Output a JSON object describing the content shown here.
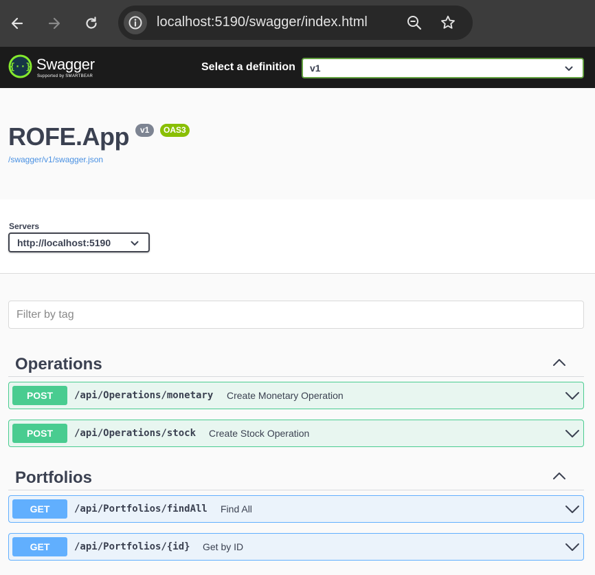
{
  "browser": {
    "url": "localhost:5190/swagger/index.html"
  },
  "topbar": {
    "logo_text": "Swagger",
    "logo_sub": "Supported by SMARTBEAR",
    "definition_label": "Select a definition",
    "definition_value": "v1"
  },
  "info": {
    "title": "ROFE.App",
    "version_badge": "v1",
    "oas_badge": "OAS3",
    "spec_link": "/swagger/v1/swagger.json"
  },
  "servers": {
    "label": "Servers",
    "selected": "http://localhost:5190"
  },
  "filter": {
    "placeholder": "Filter by tag"
  },
  "tags": [
    {
      "name": "Operations",
      "operations": [
        {
          "method": "POST",
          "path": "/api/Operations/monetary",
          "summary": "Create Monetary Operation"
        },
        {
          "method": "POST",
          "path": "/api/Operations/stock",
          "summary": "Create Stock Operation"
        }
      ]
    },
    {
      "name": "Portfolios",
      "operations": [
        {
          "method": "GET",
          "path": "/api/Portfolios/findAll",
          "summary": "Find All"
        },
        {
          "method": "GET",
          "path": "/api/Portfolios/{id}",
          "summary": "Get by ID"
        }
      ]
    }
  ],
  "colors": {
    "post": "#49cc90",
    "get": "#61affe",
    "swagger_green": "#85ea2d",
    "oas_badge": "#89bf04"
  }
}
